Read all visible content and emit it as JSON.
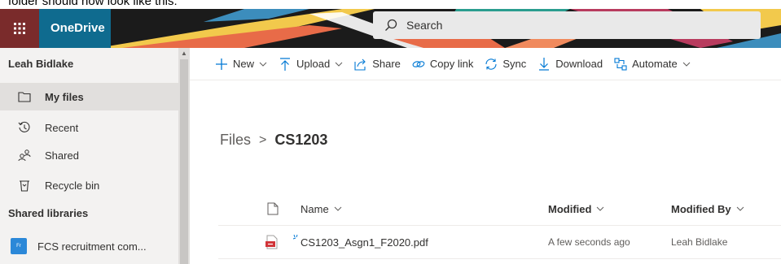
{
  "caption": {
    "text": "folder should now look like this:"
  },
  "suite": {
    "app_name": "OneDrive",
    "search_placeholder": "Search"
  },
  "sidebar": {
    "user_name": "Leah Bidlake",
    "items": [
      {
        "label": "My files",
        "icon": "folder-icon",
        "active": true
      },
      {
        "label": "Recent",
        "icon": "clock-icon"
      },
      {
        "label": "Shared",
        "icon": "people-icon"
      },
      {
        "label": "Recycle bin",
        "icon": "trash-icon"
      }
    ],
    "section_label": "Shared libraries",
    "libraries": [
      {
        "label": "FCS recruitment com...",
        "icon_text": "Fr"
      }
    ]
  },
  "commands": [
    {
      "label": "New",
      "icon": "plus-icon",
      "dropdown": true
    },
    {
      "label": "Upload",
      "icon": "upload-icon",
      "dropdown": true
    },
    {
      "label": "Share",
      "icon": "share-icon"
    },
    {
      "label": "Copy link",
      "icon": "link-icon"
    },
    {
      "label": "Sync",
      "icon": "sync-icon"
    },
    {
      "label": "Download",
      "icon": "download-icon"
    },
    {
      "label": "Automate",
      "icon": "automate-icon",
      "dropdown": true
    }
  ],
  "breadcrumb": {
    "root": "Files",
    "separator": ">",
    "current": "CS1203"
  },
  "table": {
    "columns": {
      "name": "Name",
      "modified": "Modified",
      "modified_by": "Modified By"
    },
    "rows": [
      {
        "name": "CS1203_Asgn1_F2020.pdf",
        "modified": "A few seconds ago",
        "modified_by": "Leah Bidlake",
        "icon": "pdf-file-icon"
      }
    ]
  },
  "colors": {
    "brand": "#0f6b8f",
    "waffle": "#7a2b2b",
    "accent": "#0078d4",
    "pdf": "#d13438"
  }
}
